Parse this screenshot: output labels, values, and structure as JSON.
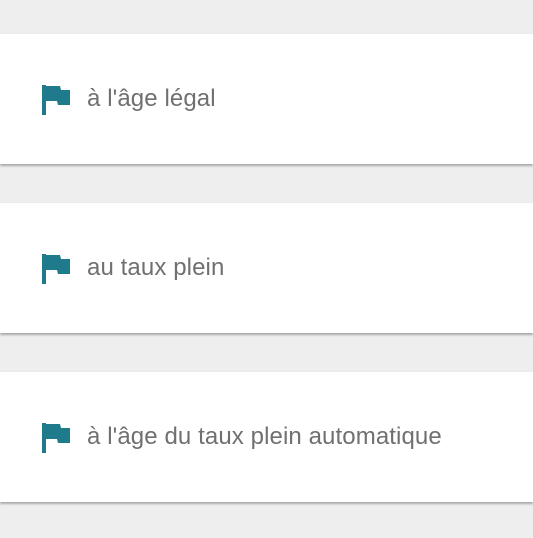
{
  "colors": {
    "background": "#eeeeee",
    "card": "#ffffff",
    "icon": "#1f7a8c",
    "text": "#707070"
  },
  "options": [
    {
      "icon": "flag-icon",
      "label": "à l'âge légal"
    },
    {
      "icon": "flag-icon",
      "label": "au taux plein"
    },
    {
      "icon": "flag-icon",
      "label": "à l'âge du taux plein automatique"
    }
  ]
}
